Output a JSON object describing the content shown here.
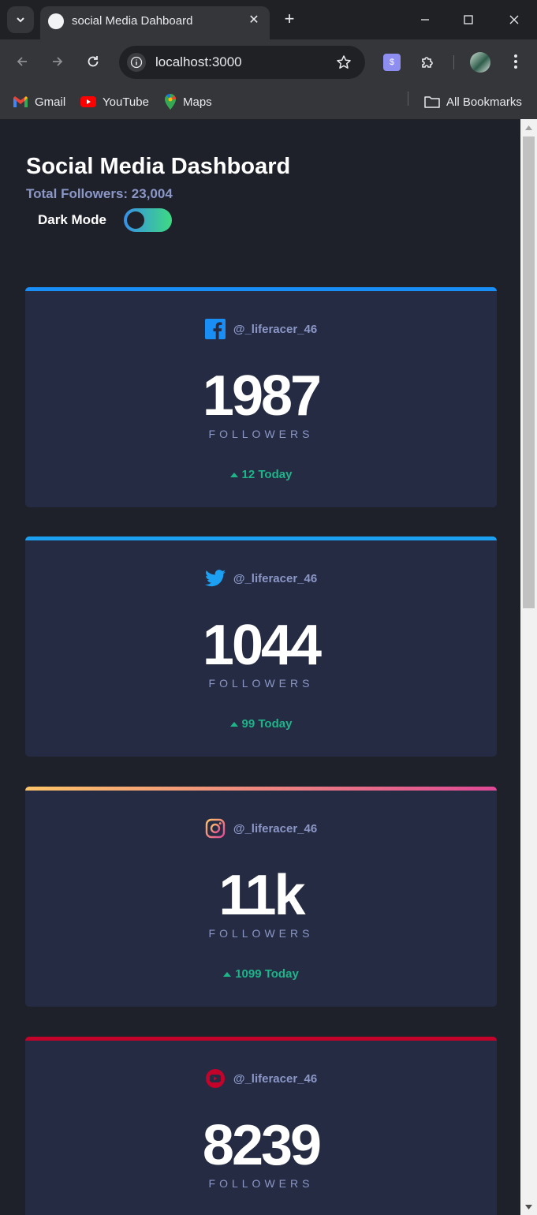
{
  "browser": {
    "tab_title": "social Media Dahboard",
    "url": "localhost:3000",
    "bookmarks": [
      {
        "label": "Gmail",
        "icon": "gmail-icon"
      },
      {
        "label": "YouTube",
        "icon": "youtube-icon"
      },
      {
        "label": "Maps",
        "icon": "maps-icon"
      }
    ],
    "all_bookmarks_label": "All Bookmarks",
    "extension_label": "$"
  },
  "header": {
    "title": "Social Media Dashboard",
    "total_followers": "Total Followers: 23,004",
    "dark_mode_label": "Dark Mode",
    "dark_mode_on": true
  },
  "cards": [
    {
      "platform": "facebook",
      "icon": "facebook-icon",
      "handle": "@_liferacer_46",
      "count": "1987",
      "label": "FOLLOWERS",
      "today": "12 Today",
      "accent": "#198ff5"
    },
    {
      "platform": "twitter",
      "icon": "twitter-icon",
      "handle": "@_liferacer_46",
      "count": "1044",
      "label": "FOLLOWERS",
      "today": "99 Today",
      "accent": "#1ca0f2"
    },
    {
      "platform": "instagram",
      "icon": "instagram-icon",
      "handle": "@_liferacer_46",
      "count": "11k",
      "label": "FOLLOWERS",
      "today": "1099 Today",
      "accent": "#fdc468"
    },
    {
      "platform": "youtube",
      "icon": "youtube-icon",
      "handle": "@_liferacer_46",
      "count": "8239",
      "label": "FOLLOWERS",
      "today": "",
      "accent": "#c4032b"
    }
  ],
  "colors": {
    "page_bg": "#1e202a",
    "card_bg": "#252b43",
    "text_primary": "#ffffff",
    "text_secondary": "#8b97c6",
    "up_green": "#1db489",
    "toggle_gradient": [
      "#378fe6",
      "#3eda82"
    ],
    "instagram_gradient": [
      "#fdc468",
      "#df4996"
    ]
  }
}
